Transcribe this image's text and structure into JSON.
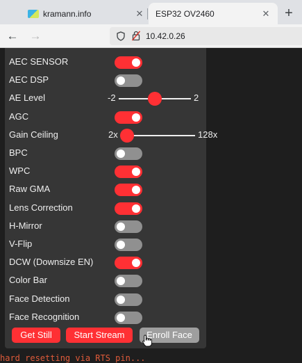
{
  "browser": {
    "tabs": [
      {
        "title": "kramann.info",
        "close": "✕"
      },
      {
        "title": "ESP32 OV2460",
        "close": "✕"
      }
    ],
    "new_tab": "+",
    "url": "10.42.0.26"
  },
  "colors": {
    "accent": "#ff3034",
    "panel": "#363636",
    "off": "#909090"
  },
  "controls": [
    {
      "label": "AEC SENSOR",
      "type": "toggle",
      "on": true
    },
    {
      "label": "AEC DSP",
      "type": "toggle",
      "on": false
    },
    {
      "label": "AE Level",
      "type": "slider",
      "min": "-2",
      "max": "2",
      "value_fraction": 0.5
    },
    {
      "label": "AGC",
      "type": "toggle",
      "on": true
    },
    {
      "label": "Gain Ceiling",
      "type": "slider",
      "min": "2x",
      "max": "128x",
      "value_fraction": 0.0
    },
    {
      "label": "BPC",
      "type": "toggle",
      "on": false
    },
    {
      "label": "WPC",
      "type": "toggle",
      "on": true
    },
    {
      "label": "Raw GMA",
      "type": "toggle",
      "on": true
    },
    {
      "label": "Lens Correction",
      "type": "toggle",
      "on": true
    },
    {
      "label": "H-Mirror",
      "type": "toggle",
      "on": false
    },
    {
      "label": "V-Flip",
      "type": "toggle",
      "on": false
    },
    {
      "label": "DCW (Downsize EN)",
      "type": "toggle",
      "on": true
    },
    {
      "label": "Color Bar",
      "type": "toggle",
      "on": false
    },
    {
      "label": "Face Detection",
      "type": "toggle",
      "on": false
    },
    {
      "label": "Face Recognition",
      "type": "toggle",
      "on": false
    }
  ],
  "buttons": {
    "get_still": "Get Still",
    "start_stream": "Start Stream",
    "enroll_face": "Enroll Face"
  },
  "console_text": "hard resetting via RTS pin..."
}
